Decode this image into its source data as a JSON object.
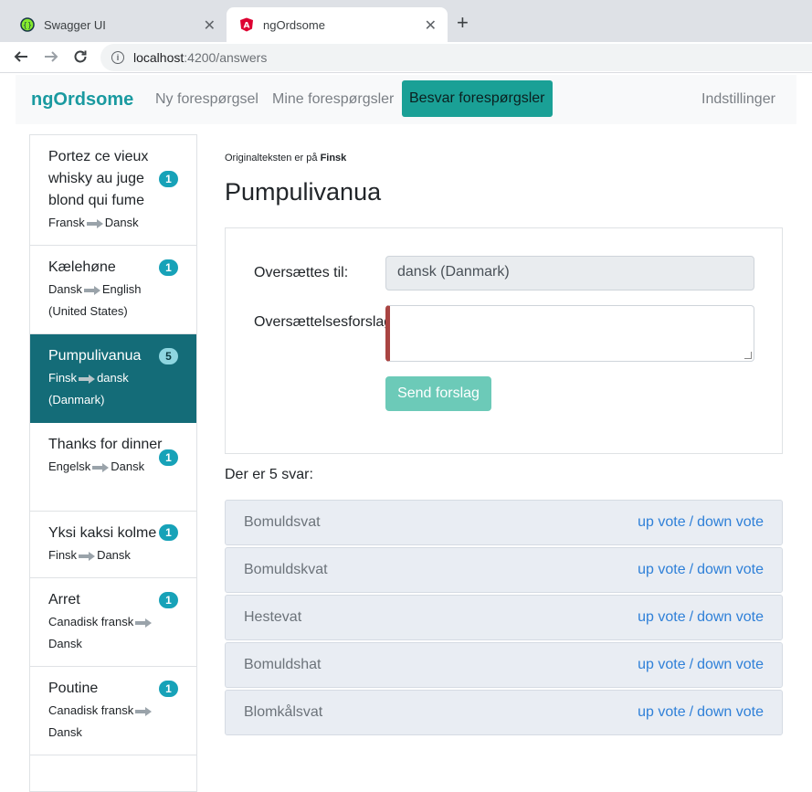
{
  "browser": {
    "tabs": [
      {
        "label": "Swagger UI",
        "icon": "swagger-icon",
        "active": false
      },
      {
        "label": "ngOrdsome",
        "icon": "angular-icon",
        "active": true
      }
    ],
    "url_host": "localhost",
    "url_path": ":4200/answers"
  },
  "nav": {
    "brand": "ngOrdsome",
    "links": [
      "Ny forespørgsel",
      "Mine forespørgsler",
      "Besvar forespørgsler"
    ],
    "active_link": "Besvar forespørgsler",
    "settings": "Indstillinger"
  },
  "requests": [
    {
      "title": "Portez ce vieux whisky au juge blond qui fume",
      "from": "Fransk",
      "to": "Dansk",
      "count": "1"
    },
    {
      "title": "Kælehøne",
      "from": "Dansk",
      "to": "English (United States)",
      "count": "1"
    },
    {
      "title": "Pumpulivanua",
      "from": "Finsk",
      "to": "dansk (Danmark)",
      "count": "5",
      "active": true
    },
    {
      "title": "Thanks for dinner",
      "from": "Engelsk",
      "to": "Dansk",
      "count": "1"
    },
    {
      "title": "Yksi kaksi kolme",
      "from": "Finsk",
      "to": "Dansk",
      "count": "1"
    },
    {
      "title": "Arret",
      "from": "Canadisk fransk",
      "to": "Dansk",
      "count": "1"
    },
    {
      "title": "Poutine",
      "from": "Canadisk fransk",
      "to": "Dansk",
      "count": "1"
    }
  ],
  "main": {
    "original_prefix": "Originalteksten er på",
    "original_lang": "Finsk",
    "title": "Pumpulivanua",
    "translate_to_label": "Oversættes til:",
    "translate_to_value": "dansk (Danmark)",
    "suggestion_label": "Oversættelsesforslag",
    "send_label": "Send forslag",
    "answers_count_text": "Der er 5 svar:",
    "answers": [
      "Bomuldsvat",
      "Bomuldskvat",
      "Hestevat",
      "Bomuldshat",
      "Blomkålsvat"
    ],
    "up_vote": "up vote",
    "down_vote": "down vote",
    "vote_sep": "/"
  },
  "colors": {
    "brand": "#1a9aa0",
    "active_item": "#146c78",
    "badge": "#17a2b8",
    "link": "#2f80d8"
  }
}
